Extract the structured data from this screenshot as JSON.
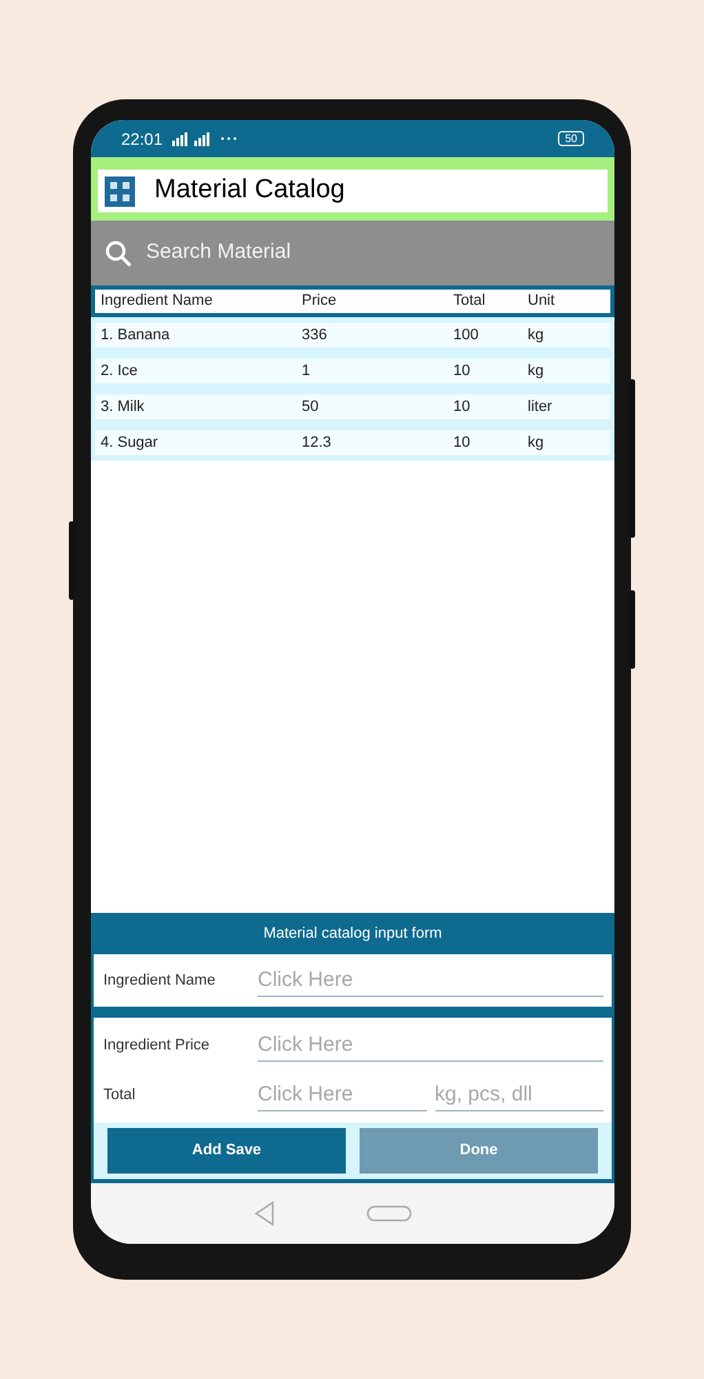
{
  "status_bar": {
    "time": "22:01",
    "battery": "50"
  },
  "app_bar": {
    "title": "Material Catalog"
  },
  "search": {
    "placeholder": "Search Material"
  },
  "table": {
    "columns": [
      "Ingredient Name",
      "Price",
      "Total",
      "Unit"
    ],
    "rows": [
      [
        "1. Banana",
        "336",
        "100",
        "kg"
      ],
      [
        "2. Ice",
        "1",
        "10",
        "kg"
      ],
      [
        "3. Milk",
        "50",
        "10",
        "liter"
      ],
      [
        "4. Sugar",
        "12.3",
        "10",
        "kg"
      ]
    ]
  },
  "form": {
    "title": "Material catalog input form",
    "fields": [
      {
        "label": "Ingredient Name",
        "inputs": [
          {
            "placeholder": "Click Here"
          }
        ]
      },
      {
        "label": "Ingredient Price",
        "inputs": [
          {
            "placeholder": "Click Here"
          }
        ]
      },
      {
        "label": "Total",
        "inputs": [
          {
            "placeholder": "Click Here"
          },
          {
            "placeholder": "kg, pcs, dll"
          }
        ]
      }
    ],
    "buttons": [
      {
        "label": "Add Save",
        "kind": "primary"
      },
      {
        "label": "Done",
        "kind": "secondary"
      }
    ]
  }
}
